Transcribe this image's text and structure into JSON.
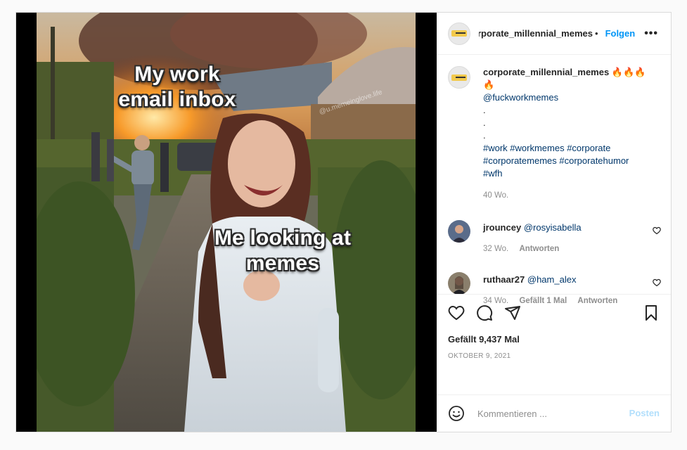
{
  "media": {
    "top_caption": "My work email inbox",
    "bottom_caption": "Me looking at memes",
    "watermark": "@u.memeinglove.life"
  },
  "header": {
    "username": "corporate_millennial_memes",
    "separator": "•",
    "follow_label": "Folgen",
    "more_label": "•••"
  },
  "caption": {
    "username": "corporate_millennial_memes",
    "emojis": "🔥🔥🔥🔥",
    "mention": "@fuckworkmemes",
    "dots": [
      ".",
      ".",
      "."
    ],
    "hashtags_line1": "#work #workmemes #corporate",
    "hashtags_line2": "#corporatememes #corporatehumor",
    "hashtags_line3": "#wfh",
    "time": "40 Wo."
  },
  "comments": [
    {
      "username": "jrouncey",
      "text": "@rosyisabella",
      "time": "32 Wo.",
      "likes": "",
      "reply_label": "Antworten"
    },
    {
      "username": "ruthaar27",
      "text": "@ham_alex",
      "time": "34 Wo.",
      "likes": "Gefällt 1 Mal",
      "reply_label": "Antworten"
    }
  ],
  "actions": {
    "likes_text": "Gefällt 9,437 Mal",
    "date": "OKTOBER 9, 2021"
  },
  "comment_box": {
    "placeholder": "Kommentieren ...",
    "post_label": "Posten"
  },
  "colors": {
    "accent": "#0095f6",
    "post_disabled": "#b2dffc",
    "muted": "#8e8e8e"
  }
}
